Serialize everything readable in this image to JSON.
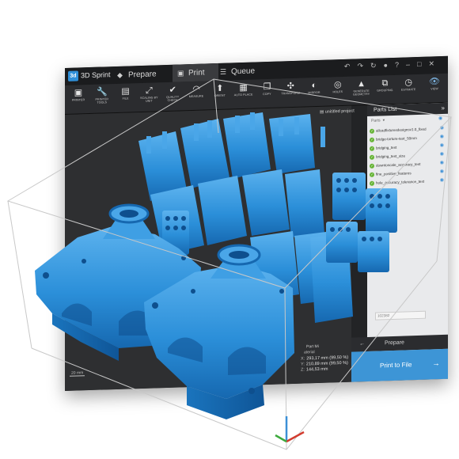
{
  "app": {
    "name": "3D Sprint",
    "logo_text": "3d"
  },
  "tabs": [
    {
      "label": "Prepare"
    },
    {
      "label": "Print"
    },
    {
      "label": "Queue"
    }
  ],
  "toolbar": [
    {
      "icon": "printer-icon",
      "glyph": "▣",
      "label": "PRINTER"
    },
    {
      "icon": "wrench-icon",
      "glyph": "🔧",
      "label": "PRINTER TOOLS"
    },
    {
      "icon": "file-icon",
      "glyph": "▤",
      "label": "FILE"
    },
    {
      "icon": "scale-icon",
      "glyph": "⤢",
      "label": "SCALING BY UNIT"
    },
    {
      "icon": "shield-check-icon",
      "glyph": "✔",
      "label": "QUALITY CHECK"
    },
    {
      "icon": "measure-icon",
      "glyph": "◠",
      "label": "MEASURE"
    },
    {
      "icon": "orient-icon",
      "glyph": "⬆",
      "label": "ORIENT"
    },
    {
      "icon": "auto-place-icon",
      "glyph": "▦",
      "label": "AUTO PLACE"
    },
    {
      "icon": "copy-icon",
      "glyph": "❐",
      "label": "COPY"
    },
    {
      "icon": "transform-icon",
      "glyph": "✣",
      "label": "TRANSFORM"
    },
    {
      "icon": "mirror-icon",
      "glyph": "◐",
      "label": "MIRROR"
    },
    {
      "icon": "holes-icon",
      "glyph": "◎",
      "label": "HOLES"
    },
    {
      "icon": "generate-geometry-icon",
      "glyph": "▲",
      "label": "GENERATE GEOMETRY"
    },
    {
      "icon": "grouping-icon",
      "glyph": "⧉",
      "label": "GROUPING"
    },
    {
      "icon": "estimate-icon",
      "glyph": "◷",
      "label": "ESTIMATE"
    },
    {
      "icon": "view-icon",
      "glyph": "👁",
      "label": "VIEW"
    }
  ],
  "project": {
    "label": "unititled project"
  },
  "parts_panel": {
    "title": "Parts List",
    "subheader": "Parts",
    "items": [
      {
        "name": "allcadfixturesdesignsv1.0_fixed"
      },
      {
        "name": "bridge-torture-test_50mm"
      },
      {
        "name": "bridging_test"
      },
      {
        "name": "bridging_test_size"
      },
      {
        "name": "downtoscale_accuracy_test"
      },
      {
        "name": "fine_positive_features"
      },
      {
        "name": "hole_accuracy_tolerance_test"
      }
    ],
    "id_value": "102382"
  },
  "viewport": {
    "scale_label": "20 mm",
    "coordinates_header": "Part Mi",
    "material_label": "aterial",
    "coords": [
      {
        "axis": "X:",
        "value": "293,17 mm (99,50 %)"
      },
      {
        "axis": "Y:",
        "value": "210,89 mm (99,50 %)"
      },
      {
        "axis": "Z:",
        "value": "144,53 mm"
      }
    ]
  },
  "actions": {
    "prepare_label": "Prepare",
    "print_label": "Print to File"
  },
  "colors": {
    "part_blue": "#2b8fd9",
    "accent_blue": "#3d95d6",
    "check_green": "#67b437"
  }
}
